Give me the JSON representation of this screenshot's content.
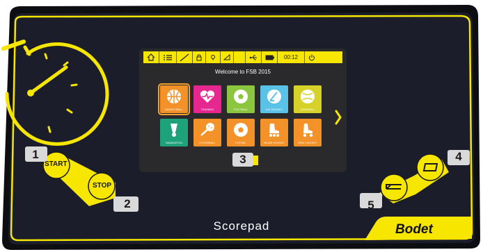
{
  "screen": {
    "status": {
      "time": "00:12"
    },
    "welcome": "Welcome to FSB 2015",
    "sports": [
      {
        "label": "BASKETBALL",
        "color": "#f4922a",
        "icon": "basketball-icon",
        "selected": true
      },
      {
        "label": "TRAINING",
        "color": "#e6278f",
        "icon": "heart-pulse-icon"
      },
      {
        "label": "FOOTBALL",
        "color": "#8cc63f",
        "icon": "football-icon"
      },
      {
        "label": "ICE HOCKEY",
        "color": "#5bc2e7",
        "icon": "ice-hockey-icon"
      },
      {
        "label": "HANDBALL",
        "color": "#d7d22a",
        "icon": "handball-icon"
      },
      {
        "label": "BADMINTON",
        "color": "#1da27a",
        "icon": "shuttlecock-icon"
      },
      {
        "label": "FLOORBALL",
        "color": "#f4922a",
        "icon": "floorball-icon"
      },
      {
        "label": "FUTSAL",
        "color": "#f4922a",
        "icon": "futsal-icon"
      },
      {
        "label": "INLINE HOCKEY",
        "color": "#f4922a",
        "icon": "inline-skate-icon"
      },
      {
        "label": "RINK HOCKEY",
        "color": "#f4922a",
        "icon": "roller-skate-icon"
      }
    ]
  },
  "buttons": {
    "start": "START",
    "stop": "STOP"
  },
  "callouts": [
    "1",
    "2",
    "3",
    "4",
    "5"
  ],
  "device": {
    "name": "Scorepad",
    "brand": "Bodet",
    "accent": "#f7e600",
    "body": "#1b1e2a"
  }
}
